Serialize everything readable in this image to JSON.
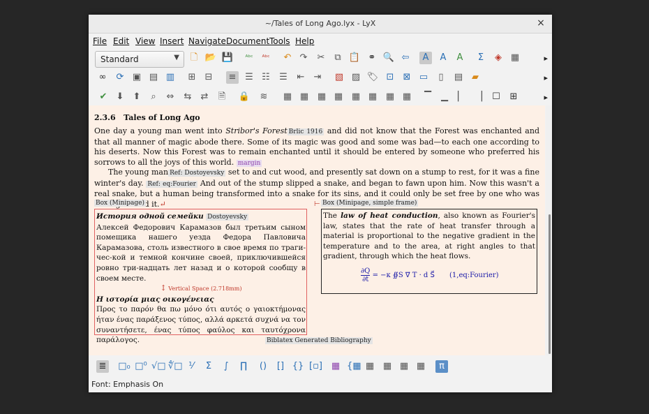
{
  "window": {
    "title": "~/Tales of Long Ago.lyx - LyX",
    "close_glyph": "×"
  },
  "menu": [
    "File",
    "Edit",
    "View",
    "Insert",
    "Navigate",
    "Document",
    "Tools",
    "Help"
  ],
  "layout_select": {
    "value": "Standard"
  },
  "toolbar_more": "▸",
  "document": {
    "section_number": "2.3.6",
    "section_title": "Tales of Long Ago",
    "p1_a": "One day a young man went into ",
    "p1_em": "Stribor's Forest",
    "p1_cite": "Brlic 1916",
    "p1_b": " and did not know that the Forest was enchanted and that all manner of magic abode there. Some of its magic was good and some was bad—to each one according to his deserts. Now this Forest was to remain enchanted until it should be entered by someone who preferred his sorrows to all the joys of this world.",
    "p1_margin": "margin",
    "p2_a": "The young man",
    "p2_ref1": "Ref: Dostoyevsky",
    "p2_b": " set to and cut wood, and presently sat down on a stump to rest, for it was a fine winter's day.",
    "p2_ref2": "Ref: eq:Fourier",
    "p2_c": " And out of the stump slipped a snake, and began to fawn upon him. Now this wasn't a real snake, but a human being transformed into a snake for its sins, and it could only be set free by one who was willing to wed it.",
    "p2_end": "↵",
    "box1_label": "Box (Minipage)",
    "box2_label": "Box (Minipage, simple frame)",
    "ru_title": "История одной семейки",
    "ru_label": "Dostoyevsky",
    "ru_text": "Алексей Федорович Карамазов был третьим сыном помещика нашего уезда Федора Павловича Карамазова, столь известного в свое время по траги-чес-кой и темной кончине своей, приключившейся ровно три-надцать лет назад и о которой сообщу в своем месте.",
    "vspace": "Vertical Space (2.718mm)",
    "gr_title": "Η ιστορία μιας οικογένειας",
    "gr_text": "Προς το παρόν θα πω μόνο ότι αυτός ο γαιοκτήμονας ήταν ένας παράξενος τύπος, αλλά αρκετά συχνά να τον συναντήσετε, ένας τύπος φαύλος και ταυτόχρονα παράλογος.",
    "law_a": "The ",
    "law_em": "law of heat conduction",
    "law_b": ", also known as Fourier's law, states that the rate of heat transfer through a material is proportional to the negative gradient in the temperature and to the area, at right angles to that gradient, through which the heat flows.",
    "eq_num": "(1,eq:Fourier)",
    "eq_lhs_num": "∂Q",
    "eq_lhs_den": "∂t",
    "eq_rhs": "= −κ ∯S ∇⃗ T · d S⃗",
    "bib_label": "Biblatex Generated Bibliography"
  },
  "status": "Font: Emphasis On"
}
